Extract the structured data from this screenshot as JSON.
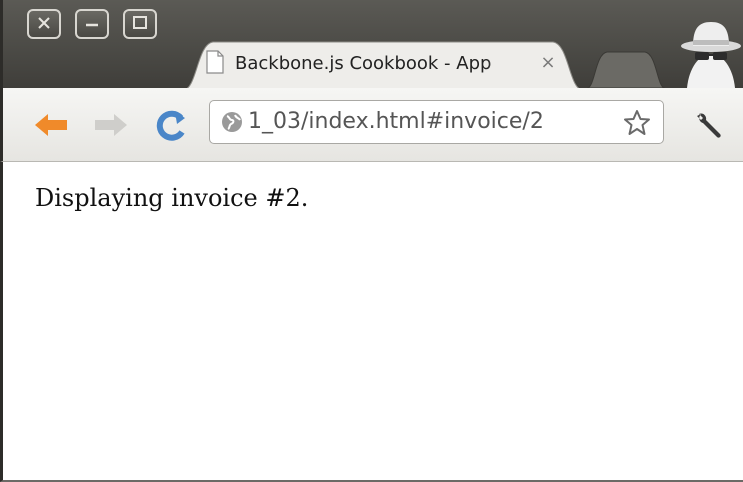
{
  "window": {
    "controls": [
      "close",
      "minimize",
      "maximize"
    ]
  },
  "tab": {
    "title": "Backbone.js Cookbook - App",
    "close_symbol": "×",
    "icon": "document-icon"
  },
  "toolbar": {
    "back_icon": "back-arrow-icon",
    "forward_icon": "forward-arrow-icon",
    "reload_icon": "reload-icon",
    "url": "1_03/index.html#invoice/2",
    "site_icon": "globe-icon",
    "bookmark_icon": "star-icon",
    "menu_icon": "wrench-icon"
  },
  "page": {
    "message": "Displaying invoice #2."
  },
  "colors": {
    "titlebar": "#4a4944",
    "back_arrow": "#f08a2a",
    "reload": "#4a86c8"
  }
}
